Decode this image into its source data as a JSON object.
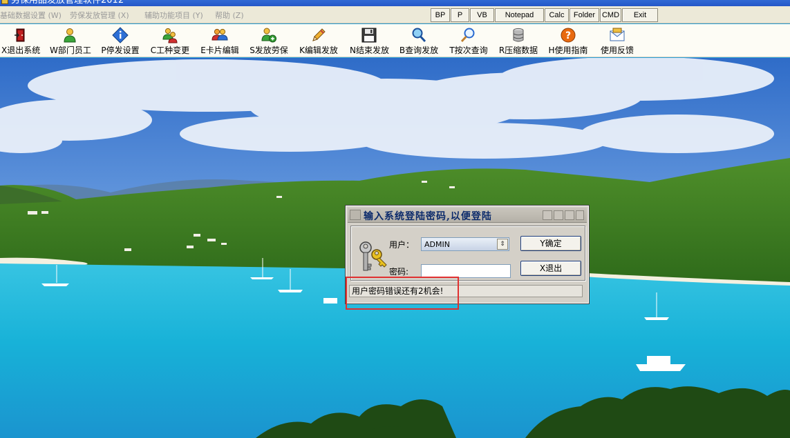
{
  "window": {
    "title": "劳保用品发放管理软件2012"
  },
  "menu": {
    "items": [
      {
        "label": "基础数据设置 (W)"
      },
      {
        "label": "劳保发放管理 (X)"
      },
      {
        "label": "辅助功能项目 (Y)"
      },
      {
        "label": "帮助 (Z)"
      }
    ]
  },
  "quickbar": {
    "buttons": [
      {
        "label": "BP"
      },
      {
        "label": "P"
      },
      {
        "label": "VB"
      },
      {
        "label": "Notepad"
      },
      {
        "label": "Calc"
      },
      {
        "label": "Folder"
      },
      {
        "label": "CMD"
      },
      {
        "label": "Exit"
      }
    ]
  },
  "toolbar": {
    "items": [
      {
        "label": "X退出系统",
        "icon": "exit-door-icon"
      },
      {
        "label": "W部门员工",
        "icon": "employee-icon"
      },
      {
        "label": "P停发设置",
        "icon": "info-icon"
      },
      {
        "label": "C工种变更",
        "icon": "users-change-icon"
      },
      {
        "label": "E卡片编辑",
        "icon": "card-edit-icon"
      },
      {
        "label": "S发放劳保",
        "icon": "user-add-icon"
      },
      {
        "label": "K编辑发放",
        "icon": "pencil-icon"
      },
      {
        "label": "N结束发放",
        "icon": "floppy-disk-icon"
      },
      {
        "label": "B查询发放",
        "icon": "search-icon"
      },
      {
        "label": "T按次查询",
        "icon": "magnifier-icon"
      },
      {
        "label": "R压缩数据",
        "icon": "database-icon"
      },
      {
        "label": "H使用指南",
        "icon": "help-icon"
      },
      {
        "label": "使用反馈",
        "icon": "mail-icon"
      }
    ]
  },
  "login_dialog": {
    "title": "输入系统登陆密码,以便登陆",
    "user_label": "用户：",
    "user_value": "ADMIN",
    "password_label": "密码:",
    "password_value": "",
    "confirm_label": "Y确定",
    "exit_label": "X退出",
    "status_message": "用户密码错误还有2机会!"
  },
  "colors": {
    "highlight_border": "#e03030",
    "dialog_title_text": "#0b2a6b",
    "menu_disabled_text": "#9a9a9a"
  }
}
